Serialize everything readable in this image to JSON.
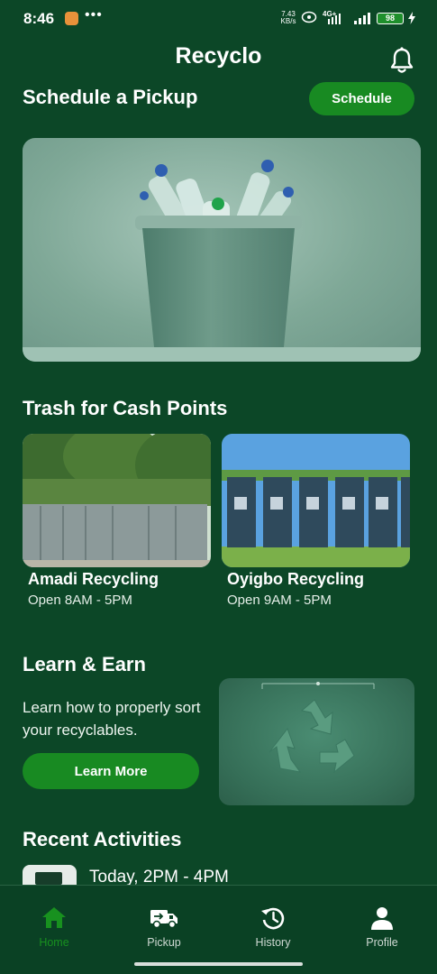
{
  "status_bar": {
    "time": "8:46",
    "dots": "•••",
    "net_speed_value": "7.43",
    "net_speed_unit": "KB/s",
    "network": "4G+",
    "battery": "98"
  },
  "app_bar": {
    "title": "Recyclo",
    "notification_icon": "bell-icon"
  },
  "schedule": {
    "title": "Schedule a Pickup",
    "button_label": "Schedule"
  },
  "cash_points": {
    "title": "Trash for Cash Points",
    "items": [
      {
        "name": "Amadi Recycling",
        "hours": "Open 8AM - 5PM"
      },
      {
        "name": "Oyigbo Recycling",
        "hours": "Open 9AM - 5PM"
      }
    ]
  },
  "learn": {
    "title": "Learn & Earn",
    "description": "Learn how to properly sort your recyclables.",
    "button_label": "Learn More",
    "image_icon": "recycle-icon"
  },
  "recent": {
    "title": "Recent Activities",
    "items": [
      {
        "time": "Today, 2PM - 4PM"
      }
    ]
  },
  "bottom_nav": {
    "items": [
      {
        "label": "Home",
        "icon": "home-icon",
        "active": true
      },
      {
        "label": "Pickup",
        "icon": "truck-icon",
        "active": false
      },
      {
        "label": "History",
        "icon": "history-icon",
        "active": false
      },
      {
        "label": "Profile",
        "icon": "person-icon",
        "active": false
      }
    ]
  },
  "colors": {
    "background": "#0c4727",
    "accent_green": "#188a22",
    "active_nav": "#18911f"
  }
}
